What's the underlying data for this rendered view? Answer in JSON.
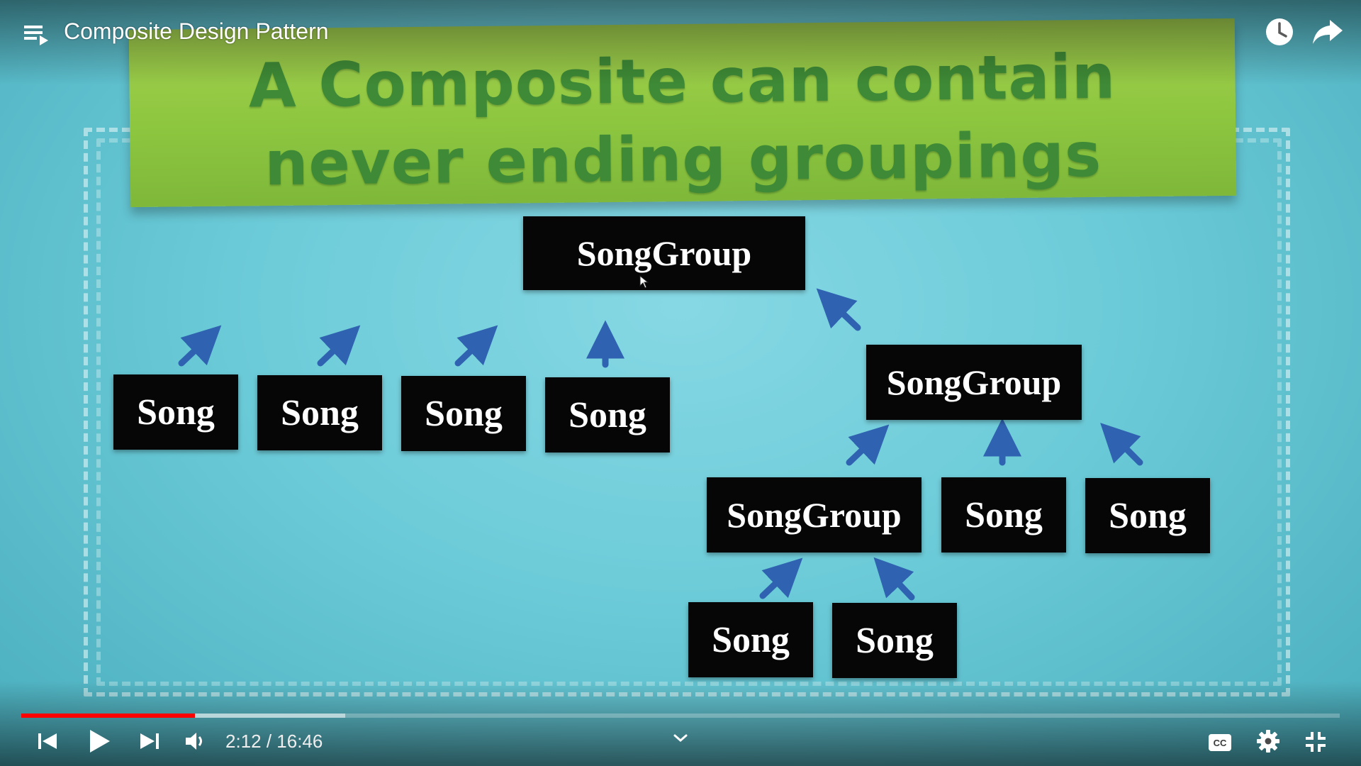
{
  "player": {
    "title": "Composite Design Pattern",
    "time_current": "2:12",
    "time_separator": " / ",
    "time_total": "16:46",
    "progress_played_fraction": 0.1317,
    "progress_buffered_fraction": 0.2457,
    "progress_color": "#ff0000"
  },
  "icons": {
    "playlist": "playlist-icon",
    "watch_later": "clock-icon",
    "share": "share-icon",
    "previous": "previous-icon",
    "play": "play-icon",
    "next": "next-icon",
    "volume": "volume-icon",
    "chevron": "chevron-down-icon",
    "captions": "cc-icon",
    "settings": "gear-icon",
    "exit_fullscreen": "exit-fullscreen-icon"
  },
  "slide": {
    "banner_text": "A Composite can contain never ending groupings",
    "banner_color": "#8dc63f",
    "arrow_color": "#2f62b0",
    "boxes": {
      "root": "SongGroup",
      "song1": "Song",
      "song2": "Song",
      "song3": "Song",
      "song4": "Song",
      "group2": "SongGroup",
      "group3": "SongGroup",
      "song5": "Song",
      "song6": "Song",
      "song7": "Song",
      "song8": "Song"
    }
  }
}
